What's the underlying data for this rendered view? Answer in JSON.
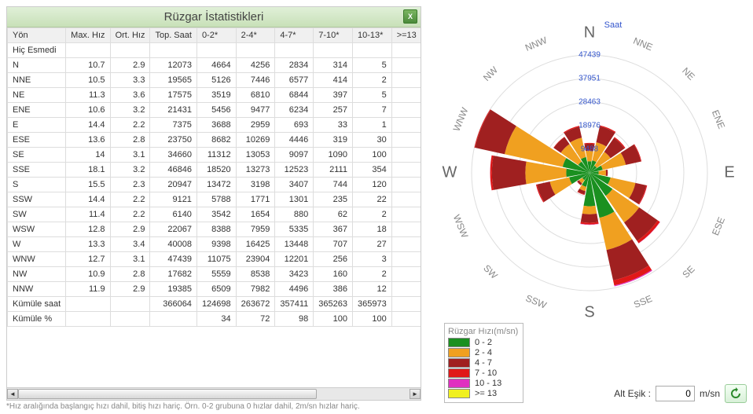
{
  "title": "Rüzgar İstatistikleri",
  "columns": [
    "Yön",
    "Max. Hız",
    "Ort. Hız",
    "Top. Saat",
    "0-2*",
    "2-4*",
    "4-7*",
    "7-10*",
    "10-13*",
    ">=13"
  ],
  "no_wind_label": "Hiç Esmedi",
  "rows": [
    {
      "dir": "N",
      "max": "10.7",
      "avg": "2.9",
      "tot": "12073",
      "b0": "4664",
      "b1": "4256",
      "b2": "2834",
      "b3": "314",
      "b4": "5"
    },
    {
      "dir": "NNE",
      "max": "10.5",
      "avg": "3.3",
      "tot": "19565",
      "b0": "5126",
      "b1": "7446",
      "b2": "6577",
      "b3": "414",
      "b4": "2"
    },
    {
      "dir": "NE",
      "max": "11.3",
      "avg": "3.6",
      "tot": "17575",
      "b0": "3519",
      "b1": "6810",
      "b2": "6844",
      "b3": "397",
      "b4": "5"
    },
    {
      "dir": "ENE",
      "max": "10.6",
      "avg": "3.2",
      "tot": "21431",
      "b0": "5456",
      "b1": "9477",
      "b2": "6234",
      "b3": "257",
      "b4": "7"
    },
    {
      "dir": "E",
      "max": "14.4",
      "avg": "2.2",
      "tot": "7375",
      "b0": "3688",
      "b1": "2959",
      "b2": "693",
      "b3": "33",
      "b4": "1"
    },
    {
      "dir": "ESE",
      "max": "13.6",
      "avg": "2.8",
      "tot": "23750",
      "b0": "8682",
      "b1": "10269",
      "b2": "4446",
      "b3": "319",
      "b4": "30"
    },
    {
      "dir": "SE",
      "max": "14",
      "avg": "3.1",
      "tot": "34660",
      "b0": "11312",
      "b1": "13053",
      "b2": "9097",
      "b3": "1090",
      "b4": "100"
    },
    {
      "dir": "SSE",
      "max": "18.1",
      "avg": "3.2",
      "tot": "46846",
      "b0": "18520",
      "b1": "13273",
      "b2": "12523",
      "b3": "2111",
      "b4": "354"
    },
    {
      "dir": "S",
      "max": "15.5",
      "avg": "2.3",
      "tot": "20947",
      "b0": "13472",
      "b1": "3198",
      "b2": "3407",
      "b3": "744",
      "b4": "120"
    },
    {
      "dir": "SSW",
      "max": "14.4",
      "avg": "2.2",
      "tot": "9121",
      "b0": "5788",
      "b1": "1771",
      "b2": "1301",
      "b3": "235",
      "b4": "22"
    },
    {
      "dir": "SW",
      "max": "11.4",
      "avg": "2.2",
      "tot": "6140",
      "b0": "3542",
      "b1": "1654",
      "b2": "880",
      "b3": "62",
      "b4": "2"
    },
    {
      "dir": "WSW",
      "max": "12.8",
      "avg": "2.9",
      "tot": "22067",
      "b0": "8388",
      "b1": "7959",
      "b2": "5335",
      "b3": "367",
      "b4": "18"
    },
    {
      "dir": "W",
      "max": "13.3",
      "avg": "3.4",
      "tot": "40008",
      "b0": "9398",
      "b1": "16425",
      "b2": "13448",
      "b3": "707",
      "b4": "27"
    },
    {
      "dir": "WNW",
      "max": "12.7",
      "avg": "3.1",
      "tot": "47439",
      "b0": "11075",
      "b1": "23904",
      "b2": "12201",
      "b3": "256",
      "b4": "3"
    },
    {
      "dir": "NW",
      "max": "10.9",
      "avg": "2.8",
      "tot": "17682",
      "b0": "5559",
      "b1": "8538",
      "b2": "3423",
      "b3": "160",
      "b4": "2"
    },
    {
      "dir": "NNW",
      "max": "11.9",
      "avg": "2.9",
      "tot": "19385",
      "b0": "6509",
      "b1": "7982",
      "b2": "4496",
      "b3": "386",
      "b4": "12"
    }
  ],
  "cum_hours_label": "Kümüle saat",
  "cum_hours": {
    "tot": "366064",
    "b0": "124698",
    "b1": "263672",
    "b2": "357411",
    "b3": "365263",
    "b4": "365973"
  },
  "cum_pct_label": "Kümüle %",
  "cum_pct": {
    "b0": "34",
    "b1": "72",
    "b2": "98",
    "b3": "100",
    "b4": "100"
  },
  "footnote": "*Hız aralığında başlangıç hızı dahil, bitiş hızı hariç. Örn. 0-2 grubuna 0 hızlar dahil, 2m/sn hızlar hariç.",
  "legend": {
    "title": "Rüzgar Hızı(m/sn)",
    "items": [
      {
        "color": "#1a9020",
        "label": "0 - 2"
      },
      {
        "color": "#f0a020",
        "label": "2 - 4"
      },
      {
        "color": "#a02020",
        "label": "4 - 7"
      },
      {
        "color": "#e01818",
        "label": "7 - 10"
      },
      {
        "color": "#e030c0",
        "label": "10 - 13"
      },
      {
        "color": "#f0f020",
        "label": ">= 13"
      }
    ]
  },
  "threshold_label": "Alt Eşik :",
  "threshold_value": "0",
  "threshold_unit": "m/sn",
  "chart_data": {
    "type": "windrose",
    "radial_label": "Saat",
    "radial_ticks": [
      9488,
      18976,
      28463,
      37951,
      47439
    ],
    "directions": [
      "N",
      "NNE",
      "NE",
      "ENE",
      "E",
      "ESE",
      "SE",
      "SSE",
      "S",
      "SSW",
      "SW",
      "WSW",
      "W",
      "WNW",
      "NW",
      "NNW"
    ],
    "series": [
      {
        "name": "0 - 2",
        "color": "#1a9020",
        "values": [
          4664,
          5126,
          3519,
          5456,
          3688,
          8682,
          11312,
          18520,
          13472,
          5788,
          3542,
          8388,
          9398,
          11075,
          5559,
          6509
        ]
      },
      {
        "name": "2 - 4",
        "color": "#f0a020",
        "values": [
          4256,
          7446,
          6810,
          9477,
          2959,
          10269,
          13053,
          13273,
          3198,
          1771,
          1654,
          7959,
          16425,
          23904,
          8538,
          7982
        ]
      },
      {
        "name": "4 - 7",
        "color": "#a02020",
        "values": [
          2834,
          6577,
          6844,
          6234,
          693,
          4446,
          9097,
          12523,
          3407,
          1301,
          880,
          5335,
          13448,
          12201,
          3423,
          4496
        ]
      },
      {
        "name": "7 - 10",
        "color": "#e01818",
        "values": [
          314,
          414,
          397,
          257,
          33,
          319,
          1090,
          2111,
          744,
          235,
          62,
          367,
          707,
          256,
          160,
          386
        ]
      },
      {
        "name": "10 - 13",
        "color": "#e030c0",
        "values": [
          5,
          2,
          5,
          7,
          1,
          30,
          100,
          354,
          120,
          22,
          2,
          18,
          27,
          3,
          2,
          12
        ]
      }
    ],
    "max_radius_value": 47439
  }
}
